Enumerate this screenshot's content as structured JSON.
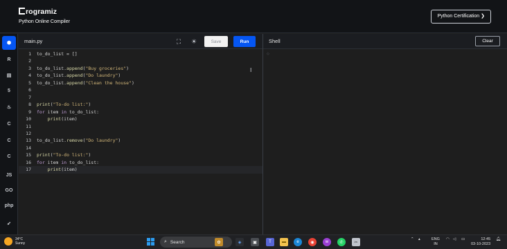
{
  "header": {
    "logo_text": "rogramiz",
    "subtitle": "Python Online Compiler",
    "cert_button": "Python Certification ❯"
  },
  "rail": {
    "items": [
      {
        "name": "python",
        "glyph": "⬢",
        "active": true
      },
      {
        "name": "r",
        "glyph": "R"
      },
      {
        "name": "sql",
        "glyph": "▤"
      },
      {
        "name": "html",
        "glyph": "5"
      },
      {
        "name": "java",
        "glyph": "♨"
      },
      {
        "name": "c",
        "glyph": "C"
      },
      {
        "name": "cpp",
        "glyph": "C"
      },
      {
        "name": "csharp",
        "glyph": "C"
      },
      {
        "name": "js",
        "glyph": "JS"
      },
      {
        "name": "go",
        "glyph": "GO"
      },
      {
        "name": "php",
        "glyph": "php"
      },
      {
        "name": "swift",
        "glyph": "➹"
      }
    ]
  },
  "editor": {
    "filename": "main.py",
    "save_label": "Save",
    "run_label": "Run",
    "lines": [
      {
        "n": "1",
        "code": "to_do_list = []"
      },
      {
        "n": "2",
        "code": ""
      },
      {
        "n": "3",
        "code": "to_do_list.append(\"Buy groceries\")"
      },
      {
        "n": "4",
        "code": "to_do_list.append(\"Do laundry\")"
      },
      {
        "n": "5",
        "code": "to_do_list.append(\"Clean the house\")"
      },
      {
        "n": "6",
        "code": ""
      },
      {
        "n": "7",
        "code": ""
      },
      {
        "n": "8",
        "code": "print(\"To-do list:\")"
      },
      {
        "n": "9",
        "code": "for item in to_do_list:"
      },
      {
        "n": "10",
        "code": "    print(item)"
      },
      {
        "n": "11",
        "code": ""
      },
      {
        "n": "12",
        "code": ""
      },
      {
        "n": "13",
        "code": "to_do_list.remove(\"Do laundry\")"
      },
      {
        "n": "14",
        "code": ""
      },
      {
        "n": "15",
        "code": "print(\"To-do list:\")"
      },
      {
        "n": "16",
        "code": "for item in to_do_list:"
      },
      {
        "n": "17",
        "code": "    print(item)"
      }
    ]
  },
  "shell": {
    "title": "Shell",
    "clear_label": "Clear"
  },
  "taskbar": {
    "temperature": "34°C",
    "condition": "Sunny",
    "search_label": "Search",
    "lang": "ENG",
    "region": "IN",
    "time": "12:45",
    "date": "03-10-2023"
  }
}
